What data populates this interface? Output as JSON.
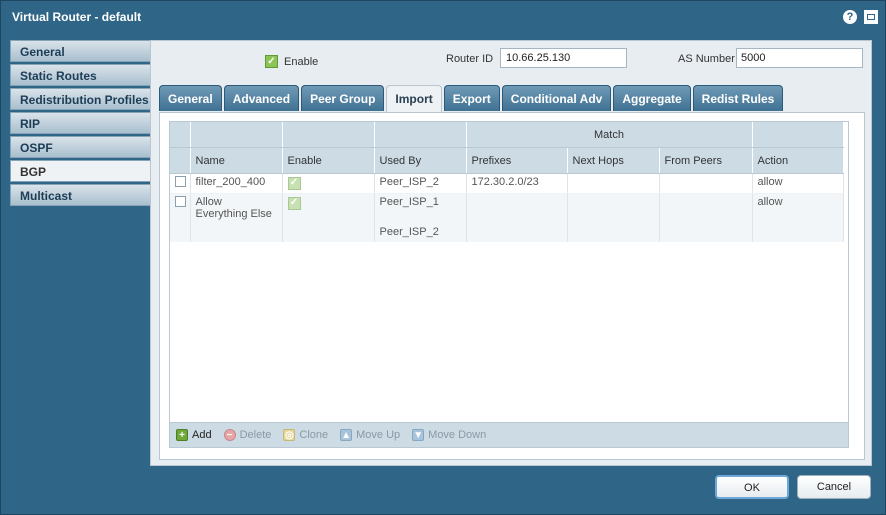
{
  "window": {
    "title": "Virtual Router - default",
    "help_icon": "?"
  },
  "sidebar": {
    "items": [
      {
        "label": "General",
        "active": false
      },
      {
        "label": "Static Routes",
        "active": false
      },
      {
        "label": "Redistribution Profiles",
        "active": false
      },
      {
        "label": "RIP",
        "active": false
      },
      {
        "label": "OSPF",
        "active": false
      },
      {
        "label": "BGP",
        "active": true
      },
      {
        "label": "Multicast",
        "active": false
      }
    ]
  },
  "bgp": {
    "enable_label": "Enable",
    "enable_checked": true,
    "router_id_label": "Router ID",
    "router_id_value": "10.66.25.130",
    "as_number_label": "AS Number",
    "as_number_value": "5000"
  },
  "tabs": [
    {
      "label": "General",
      "active": false
    },
    {
      "label": "Advanced",
      "active": false
    },
    {
      "label": "Peer Group",
      "active": false
    },
    {
      "label": "Import",
      "active": true
    },
    {
      "label": "Export",
      "active": false
    },
    {
      "label": "Conditional Adv",
      "active": false
    },
    {
      "label": "Aggregate",
      "active": false
    },
    {
      "label": "Redist Rules",
      "active": false
    }
  ],
  "table": {
    "group_header": "Match",
    "columns": [
      "Name",
      "Enable",
      "Used By",
      "Prefixes",
      "Next Hops",
      "From Peers",
      "Action"
    ],
    "rows": [
      {
        "name": "filter_200_400",
        "enabled": true,
        "used_by": [
          "Peer_ISP_2"
        ],
        "prefixes": "172.30.2.0/23",
        "next_hops": "",
        "from_peers": "",
        "action": "allow"
      },
      {
        "name": "Allow Everything Else",
        "enabled": true,
        "used_by": [
          "Peer_ISP_1",
          "",
          "Peer_ISP_2"
        ],
        "prefixes": "",
        "next_hops": "",
        "from_peers": "",
        "action": "allow"
      }
    ]
  },
  "toolbar": {
    "add": "Add",
    "delete": "Delete",
    "clone": "Clone",
    "move_up": "Move Up",
    "move_down": "Move Down"
  },
  "buttons": {
    "ok": "OK",
    "cancel": "Cancel"
  },
  "colors": {
    "frame": "#2f6587",
    "tab_active": "#eef2f5",
    "accent_check": "#8cc456"
  }
}
